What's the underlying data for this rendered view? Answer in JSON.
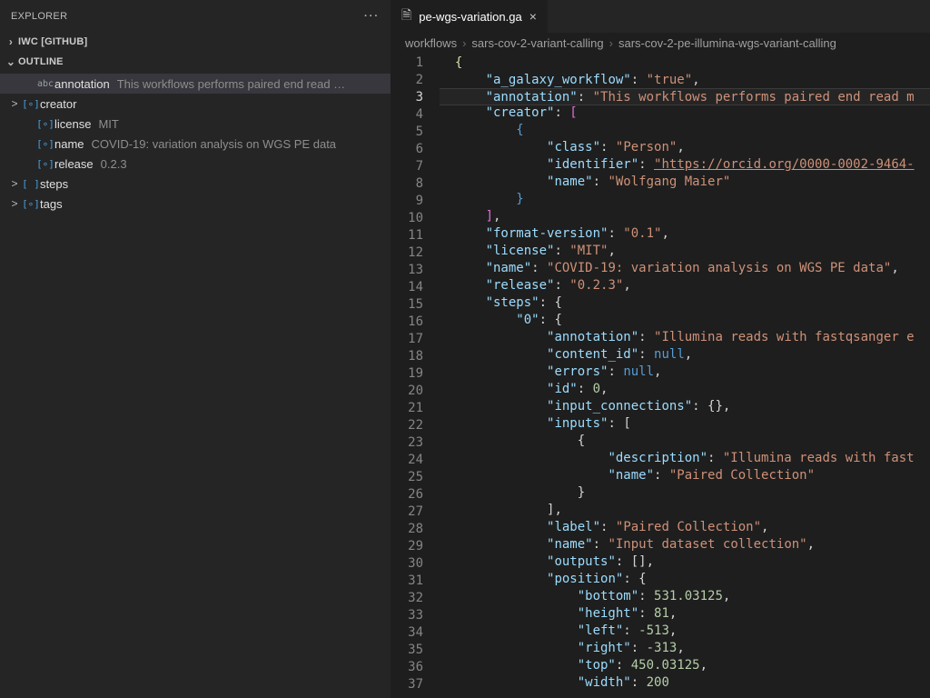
{
  "sidebar": {
    "title": "EXPLORER",
    "more_icon": "···",
    "sections": [
      {
        "id": "iwc",
        "label": "IWC [GITHUB]",
        "expanded": false
      },
      {
        "id": "outline",
        "label": "OUTLINE",
        "expanded": true
      }
    ],
    "outline": [
      {
        "chev": "",
        "icon": "abc",
        "icon_text": "abc",
        "name": "annotation",
        "value": "This workflows performs paired end read …",
        "active": true,
        "indent": 1
      },
      {
        "chev": ">",
        "icon": "bracket",
        "icon_text": "[∘]",
        "name": "creator",
        "value": "",
        "active": false,
        "indent": 0
      },
      {
        "chev": "",
        "icon": "bracket",
        "icon_text": "[∘]",
        "name": "license",
        "value": "MIT",
        "active": false,
        "indent": 1
      },
      {
        "chev": "",
        "icon": "bracket",
        "icon_text": "[∘]",
        "name": "name",
        "value": "COVID-19: variation analysis on WGS PE data",
        "active": false,
        "indent": 1
      },
      {
        "chev": "",
        "icon": "bracket",
        "icon_text": "[∘]",
        "name": "release",
        "value": "0.2.3",
        "active": false,
        "indent": 1
      },
      {
        "chev": ">",
        "icon": "bracket",
        "icon_text": "[ ]",
        "name": "steps",
        "value": "",
        "active": false,
        "indent": 0
      },
      {
        "chev": ">",
        "icon": "bracket",
        "icon_text": "[∘]",
        "name": "tags",
        "value": "",
        "active": false,
        "indent": 0
      }
    ]
  },
  "tab": {
    "file_icon": "🗎",
    "filename": "pe-wgs-variation.ga",
    "close": "×"
  },
  "breadcrumb": {
    "sep": "›",
    "parts": [
      "workflows",
      "sars-cov-2-variant-calling",
      "sars-cov-2-pe-illumina-wgs-variant-calling"
    ]
  },
  "editor": {
    "current_line": 3,
    "lines": [
      {
        "n": 1,
        "indent": 0,
        "html": "<span class='brace-y'>{</span>"
      },
      {
        "n": 2,
        "indent": 1,
        "html": "<span class='k'>\"a_galaxy_workflow\"</span><span class='p'>: </span><span class='s'>\"true\"</span><span class='p'>,</span>"
      },
      {
        "n": 3,
        "indent": 1,
        "html": "<span class='k'>\"annotation\"</span><span class='p'>: </span><span class='s'>\"This workflows performs paired end read m</span>"
      },
      {
        "n": 4,
        "indent": 1,
        "html": "<span class='k'>\"creator\"</span><span class='p'>: </span><span class='brace'>[</span>"
      },
      {
        "n": 5,
        "indent": 2,
        "html": "<span class='c'>{</span>"
      },
      {
        "n": 6,
        "indent": 3,
        "html": "<span class='k'>\"class\"</span><span class='p'>: </span><span class='s'>\"Person\"</span><span class='p'>,</span>"
      },
      {
        "n": 7,
        "indent": 3,
        "html": "<span class='k'>\"identifier\"</span><span class='p'>: </span><span class='s u'>\"https://orcid.org/0000-0002-9464-</span>"
      },
      {
        "n": 8,
        "indent": 3,
        "html": "<span class='k'>\"name\"</span><span class='p'>: </span><span class='s'>\"Wolfgang Maier\"</span>"
      },
      {
        "n": 9,
        "indent": 2,
        "html": "<span class='c'>}</span>"
      },
      {
        "n": 10,
        "indent": 1,
        "html": "<span class='brace'>]</span><span class='p'>,</span>"
      },
      {
        "n": 11,
        "indent": 1,
        "html": "<span class='k'>\"format-version\"</span><span class='p'>: </span><span class='s'>\"0.1\"</span><span class='p'>,</span>"
      },
      {
        "n": 12,
        "indent": 1,
        "html": "<span class='k'>\"license\"</span><span class='p'>: </span><span class='s'>\"MIT\"</span><span class='p'>,</span>"
      },
      {
        "n": 13,
        "indent": 1,
        "html": "<span class='k'>\"name\"</span><span class='p'>: </span><span class='s'>\"COVID-19: variation analysis on WGS PE data\"</span><span class='p'>,</span>"
      },
      {
        "n": 14,
        "indent": 1,
        "html": "<span class='k'>\"release\"</span><span class='p'>: </span><span class='s'>\"0.2.3\"</span><span class='p'>,</span>"
      },
      {
        "n": 15,
        "indent": 1,
        "html": "<span class='k'>\"steps\"</span><span class='p'>: </span><span class='p'>{</span>"
      },
      {
        "n": 16,
        "indent": 2,
        "html": "<span class='k'>\"0\"</span><span class='p'>: </span><span class='p'>{</span>"
      },
      {
        "n": 17,
        "indent": 3,
        "html": "<span class='k'>\"annotation\"</span><span class='p'>: </span><span class='s'>\"Illumina reads with fastqsanger e</span>"
      },
      {
        "n": 18,
        "indent": 3,
        "html": "<span class='k'>\"content_id\"</span><span class='p'>: </span><span class='c'>null</span><span class='p'>,</span>"
      },
      {
        "n": 19,
        "indent": 3,
        "html": "<span class='k'>\"errors\"</span><span class='p'>: </span><span class='c'>null</span><span class='p'>,</span>"
      },
      {
        "n": 20,
        "indent": 3,
        "html": "<span class='k'>\"id\"</span><span class='p'>: </span><span class='n'>0</span><span class='p'>,</span>"
      },
      {
        "n": 21,
        "indent": 3,
        "html": "<span class='k'>\"input_connections\"</span><span class='p'>: </span><span class='p'>{}</span><span class='p'>,</span>"
      },
      {
        "n": 22,
        "indent": 3,
        "html": "<span class='k'>\"inputs\"</span><span class='p'>: </span><span class='p'>[</span>"
      },
      {
        "n": 23,
        "indent": 4,
        "html": "<span class='p'>{</span>"
      },
      {
        "n": 24,
        "indent": 5,
        "html": "<span class='k'>\"description\"</span><span class='p'>: </span><span class='s'>\"Illumina reads with fast</span>"
      },
      {
        "n": 25,
        "indent": 5,
        "html": "<span class='k'>\"name\"</span><span class='p'>: </span><span class='s'>\"Paired Collection\"</span>"
      },
      {
        "n": 26,
        "indent": 4,
        "html": "<span class='p'>}</span>"
      },
      {
        "n": 27,
        "indent": 3,
        "html": "<span class='p'>]</span><span class='p'>,</span>"
      },
      {
        "n": 28,
        "indent": 3,
        "html": "<span class='k'>\"label\"</span><span class='p'>: </span><span class='s'>\"Paired Collection\"</span><span class='p'>,</span>"
      },
      {
        "n": 29,
        "indent": 3,
        "html": "<span class='k'>\"name\"</span><span class='p'>: </span><span class='s'>\"Input dataset collection\"</span><span class='p'>,</span>"
      },
      {
        "n": 30,
        "indent": 3,
        "html": "<span class='k'>\"outputs\"</span><span class='p'>: </span><span class='p'>[]</span><span class='p'>,</span>"
      },
      {
        "n": 31,
        "indent": 3,
        "html": "<span class='k'>\"position\"</span><span class='p'>: </span><span class='p'>{</span>"
      },
      {
        "n": 32,
        "indent": 4,
        "html": "<span class='k'>\"bottom\"</span><span class='p'>: </span><span class='n'>531.03125</span><span class='p'>,</span>"
      },
      {
        "n": 33,
        "indent": 4,
        "html": "<span class='k'>\"height\"</span><span class='p'>: </span><span class='n'>81</span><span class='p'>,</span>"
      },
      {
        "n": 34,
        "indent": 4,
        "html": "<span class='k'>\"left\"</span><span class='p'>: </span><span class='n'>-513</span><span class='p'>,</span>"
      },
      {
        "n": 35,
        "indent": 4,
        "html": "<span class='k'>\"right\"</span><span class='p'>: </span><span class='n'>-313</span><span class='p'>,</span>"
      },
      {
        "n": 36,
        "indent": 4,
        "html": "<span class='k'>\"top\"</span><span class='p'>: </span><span class='n'>450.03125</span><span class='p'>,</span>"
      },
      {
        "n": 37,
        "indent": 4,
        "html": "<span class='k'>\"width\"</span><span class='p'>: </span><span class='n'>200</span>"
      }
    ]
  }
}
